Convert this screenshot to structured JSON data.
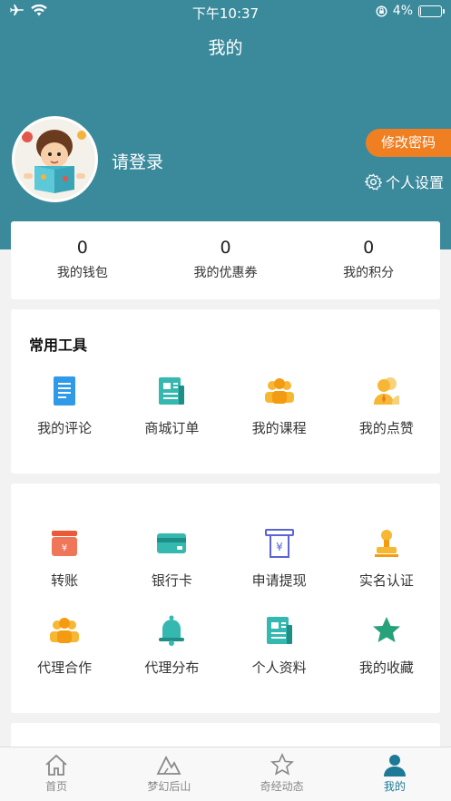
{
  "status_bar": {
    "time": "下午10:37",
    "battery": "4%"
  },
  "nav": {
    "title": "我的"
  },
  "profile": {
    "login_prompt": "请登录",
    "change_password": "修改密码",
    "settings": "个人设置"
  },
  "stats": [
    {
      "value": "0",
      "label": "我的钱包"
    },
    {
      "value": "0",
      "label": "我的优惠券"
    },
    {
      "value": "0",
      "label": "我的积分"
    }
  ],
  "tools": {
    "title": "常用工具",
    "items": [
      {
        "label": "我的评论",
        "icon": "document-icon"
      },
      {
        "label": "商城订单",
        "icon": "order-icon"
      },
      {
        "label": "我的课程",
        "icon": "group-icon"
      },
      {
        "label": "我的点赞",
        "icon": "users-like-icon"
      }
    ]
  },
  "more": {
    "items": [
      {
        "label": "转账",
        "icon": "wallet-icon"
      },
      {
        "label": "银行卡",
        "icon": "bank-card-icon"
      },
      {
        "label": "申请提现",
        "icon": "withdraw-icon"
      },
      {
        "label": "实名认证",
        "icon": "stamp-icon"
      },
      {
        "label": "代理合作",
        "icon": "agent-group-icon"
      },
      {
        "label": "代理分布",
        "icon": "bell-icon"
      },
      {
        "label": "个人资料",
        "icon": "profile-doc-icon"
      },
      {
        "label": "我的收藏",
        "icon": "star-icon"
      }
    ]
  },
  "tabbar": [
    {
      "label": "首页",
      "icon": "home-icon"
    },
    {
      "label": "梦幻后山",
      "icon": "mountain-icon"
    },
    {
      "label": "奇经动态",
      "icon": "star-outline-icon"
    },
    {
      "label": "我的",
      "icon": "person-icon",
      "active": true
    }
  ],
  "colors": {
    "header": "#3b8a9c",
    "accent_orange": "#f07f22",
    "active_tab": "#1d7a96"
  }
}
